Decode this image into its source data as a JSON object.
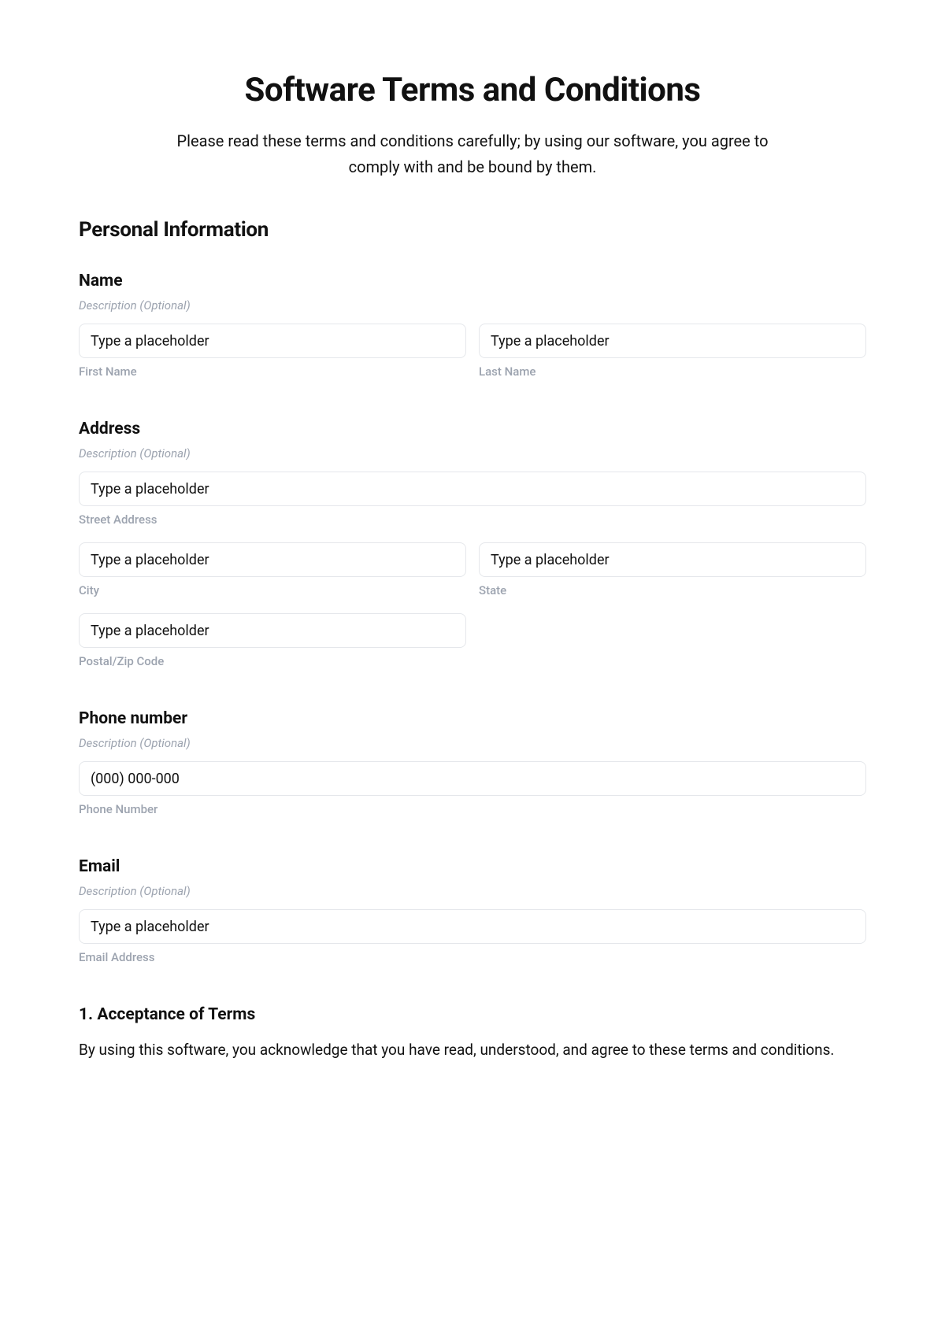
{
  "header": {
    "title": "Software Terms and Conditions",
    "subtitle": "Please read these terms and conditions carefully; by using our software, you agree to comply with and be bound by them."
  },
  "section": {
    "title": "Personal Information"
  },
  "name": {
    "label": "Name",
    "desc": "Description (Optional)",
    "first": {
      "placeholder": "Type a placeholder",
      "sub": "First Name"
    },
    "last": {
      "placeholder": "Type a placeholder",
      "sub": "Last Name"
    }
  },
  "address": {
    "label": "Address",
    "desc": "Description (Optional)",
    "street": {
      "placeholder": "Type a placeholder",
      "sub": "Street Address"
    },
    "city": {
      "placeholder": "Type a placeholder",
      "sub": "City"
    },
    "state": {
      "placeholder": "Type a placeholder",
      "sub": "State"
    },
    "zip": {
      "placeholder": "Type a placeholder",
      "sub": "Postal/Zip Code"
    }
  },
  "phone": {
    "label": "Phone number",
    "desc": "Description (Optional)",
    "number": {
      "placeholder": "(000) 000-000",
      "sub": "Phone Number"
    }
  },
  "email": {
    "label": "Email",
    "desc": "Description (Optional)",
    "addr": {
      "placeholder": "Type a placeholder",
      "sub": "Email Address"
    }
  },
  "terms": {
    "s1": {
      "title": "1. Acceptance of Terms",
      "body": "By using this software, you acknowledge that you have read, understood, and agree to these terms and conditions."
    }
  }
}
